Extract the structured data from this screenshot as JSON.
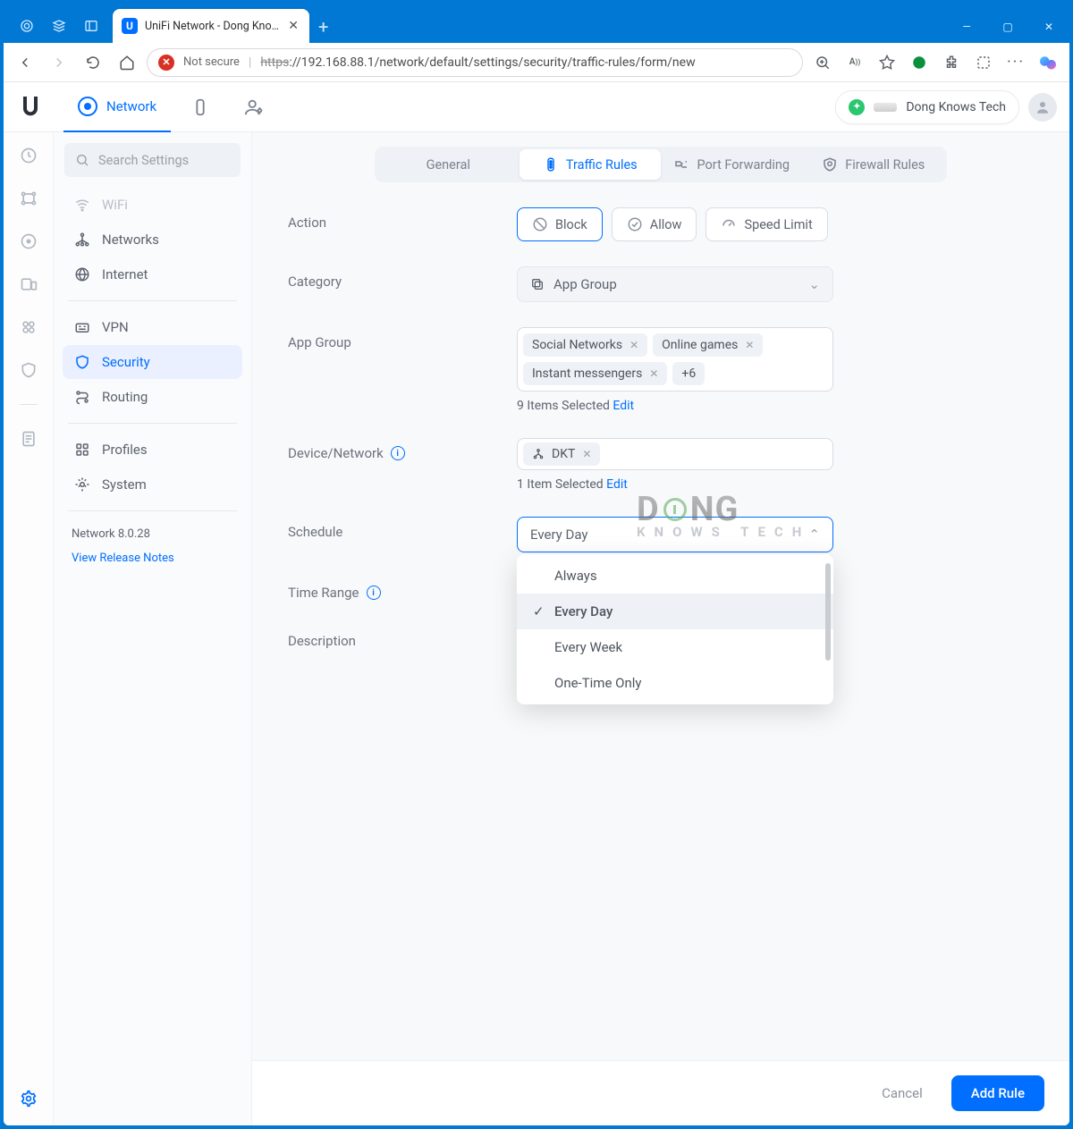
{
  "browser": {
    "tab_title": "UniFi Network - Dong Knows Tec",
    "not_secure": "Not secure",
    "url_https": "https",
    "url_rest": "://192.168.88.1/network/default/settings/security/traffic-rules/form/new"
  },
  "header": {
    "network_label": "Network",
    "account_name": "Dong Knows Tech"
  },
  "settings_search_placeholder": "Search Settings",
  "settings_nav": {
    "wifi": "WiFi",
    "networks": "Networks",
    "internet": "Internet",
    "vpn": "VPN",
    "security": "Security",
    "routing": "Routing",
    "profiles": "Profiles",
    "system": "System",
    "version": "Network 8.0.28",
    "release_notes": "View Release Notes"
  },
  "tabs": {
    "general": "General",
    "traffic_rules": "Traffic Rules",
    "port_forwarding": "Port Forwarding",
    "firewall_rules": "Firewall Rules"
  },
  "form": {
    "action_label": "Action",
    "block": "Block",
    "allow": "Allow",
    "speed_limit": "Speed Limit",
    "category_label": "Category",
    "category_value": "App Group",
    "app_group_label": "App Group",
    "chips": {
      "c1": "Social Networks",
      "c2": "Online games",
      "c3": "Instant messengers",
      "more": "+6"
    },
    "app_group_status": "9 Items Selected ",
    "edit": "Edit",
    "device_label": "Device/Network",
    "device_chip": "DKT",
    "device_status": "1 Item Selected ",
    "schedule_label": "Schedule",
    "schedule_value": "Every Day",
    "schedule_options": {
      "o1": "Always",
      "o2": "Every Day",
      "o3": "Every Week",
      "o4": "One-Time Only"
    },
    "time_range_label": "Time Range",
    "description_label": "Description"
  },
  "footer": {
    "cancel": "Cancel",
    "add_rule": "Add Rule"
  },
  "watermark": {
    "l1a": "D",
    "l1b": "NG",
    "l2": "KNOWS TECH"
  }
}
